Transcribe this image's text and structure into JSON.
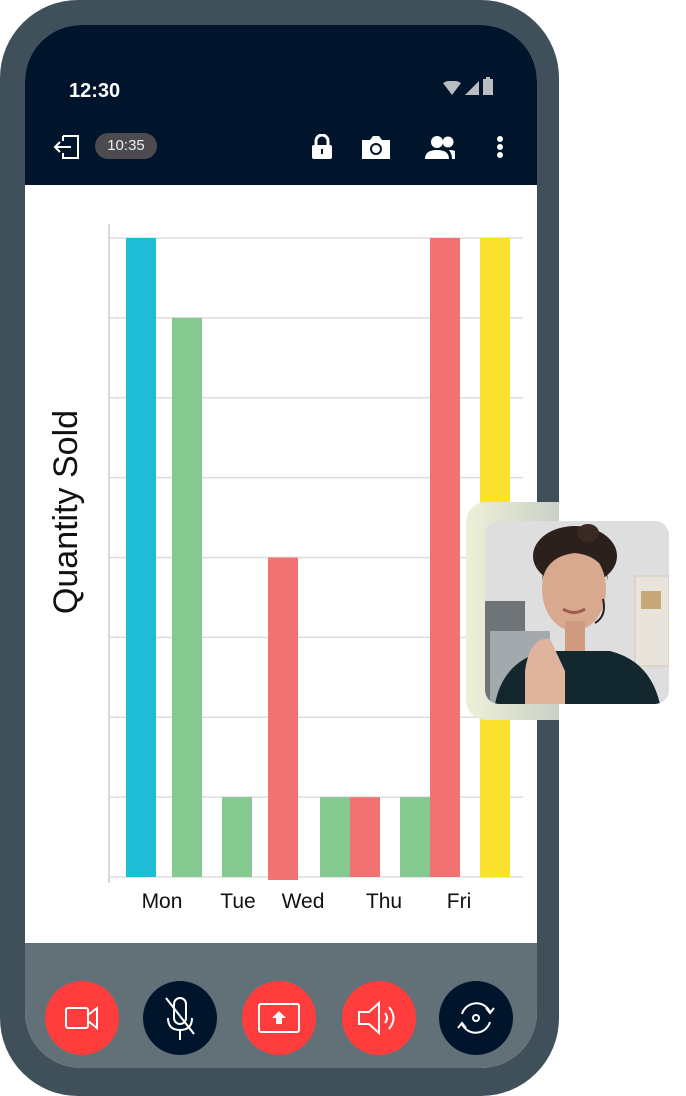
{
  "status_bar": {
    "time": "12:30",
    "icons": [
      "wifi-icon",
      "signal-icon",
      "battery-icon"
    ]
  },
  "toolbar": {
    "timer": "10:35",
    "icons": [
      "exit-icon",
      "lock-icon",
      "camera-icon",
      "participants-icon",
      "more-icon"
    ]
  },
  "chart_data": {
    "type": "bar",
    "ylabel": "Quantity Sold",
    "categories": [
      "Mon",
      "Tue",
      "Wed",
      "Thu",
      "Fri"
    ],
    "ylim": [
      0,
      8
    ],
    "grid": true,
    "bars": [
      {
        "category": "Mon",
        "color": "#1fbcd6",
        "value": 8
      },
      {
        "category": "Mon",
        "color": "#84c98f",
        "value": 7
      },
      {
        "category": "Tue",
        "color": "#84c98f",
        "value": 1
      },
      {
        "category": "Wed",
        "color": "#f07272",
        "value": 4
      },
      {
        "category": "Thu",
        "color": "#84c98f",
        "value": 1
      },
      {
        "category": "Thu",
        "color": "#f07272",
        "value": 1
      },
      {
        "category": "Fri",
        "color": "#84c98f",
        "value": 1
      },
      {
        "category": "Fri",
        "color": "#f07272",
        "value": 8
      },
      {
        "category": "Fri",
        "color": "#fbe22e",
        "value": 8
      }
    ]
  },
  "controls": [
    {
      "name": "camera-toggle",
      "icon": "video-camera-icon",
      "color": "#ff3d3d"
    },
    {
      "name": "mute-toggle",
      "icon": "mic-off-icon",
      "color": "#00152b"
    },
    {
      "name": "share-screen",
      "icon": "share-screen-icon",
      "color": "#ff3d3d"
    },
    {
      "name": "speaker-toggle",
      "icon": "speaker-icon",
      "color": "#ff3d3d"
    },
    {
      "name": "switch-camera",
      "icon": "rotate-camera-icon",
      "color": "#00152b"
    }
  ]
}
